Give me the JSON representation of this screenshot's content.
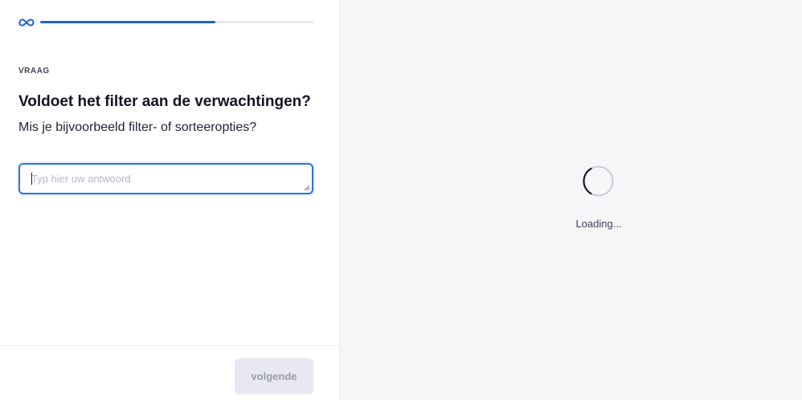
{
  "header": {
    "logo_icon": "infinity-logo-icon",
    "progress_value": 0.64
  },
  "question": {
    "eyebrow": "VRAAG",
    "title": "Voldoet het filter aan de verwachtingen?",
    "subtitle": "Mis je bijvoorbeeld filter- of sorteeropties?"
  },
  "answer": {
    "placeholder": "Typ hier uw antwoord",
    "value": ""
  },
  "footer": {
    "next_label": "volgende"
  },
  "preview": {
    "spinner_icon": "loading-spinner-icon",
    "loading_text": "Loading..."
  },
  "colors": {
    "accent": "#1e66d6",
    "focus_border": "#2f74e0",
    "button_disabled_bg": "#e7e8f0",
    "preview_bg": "#f6f6f9"
  }
}
